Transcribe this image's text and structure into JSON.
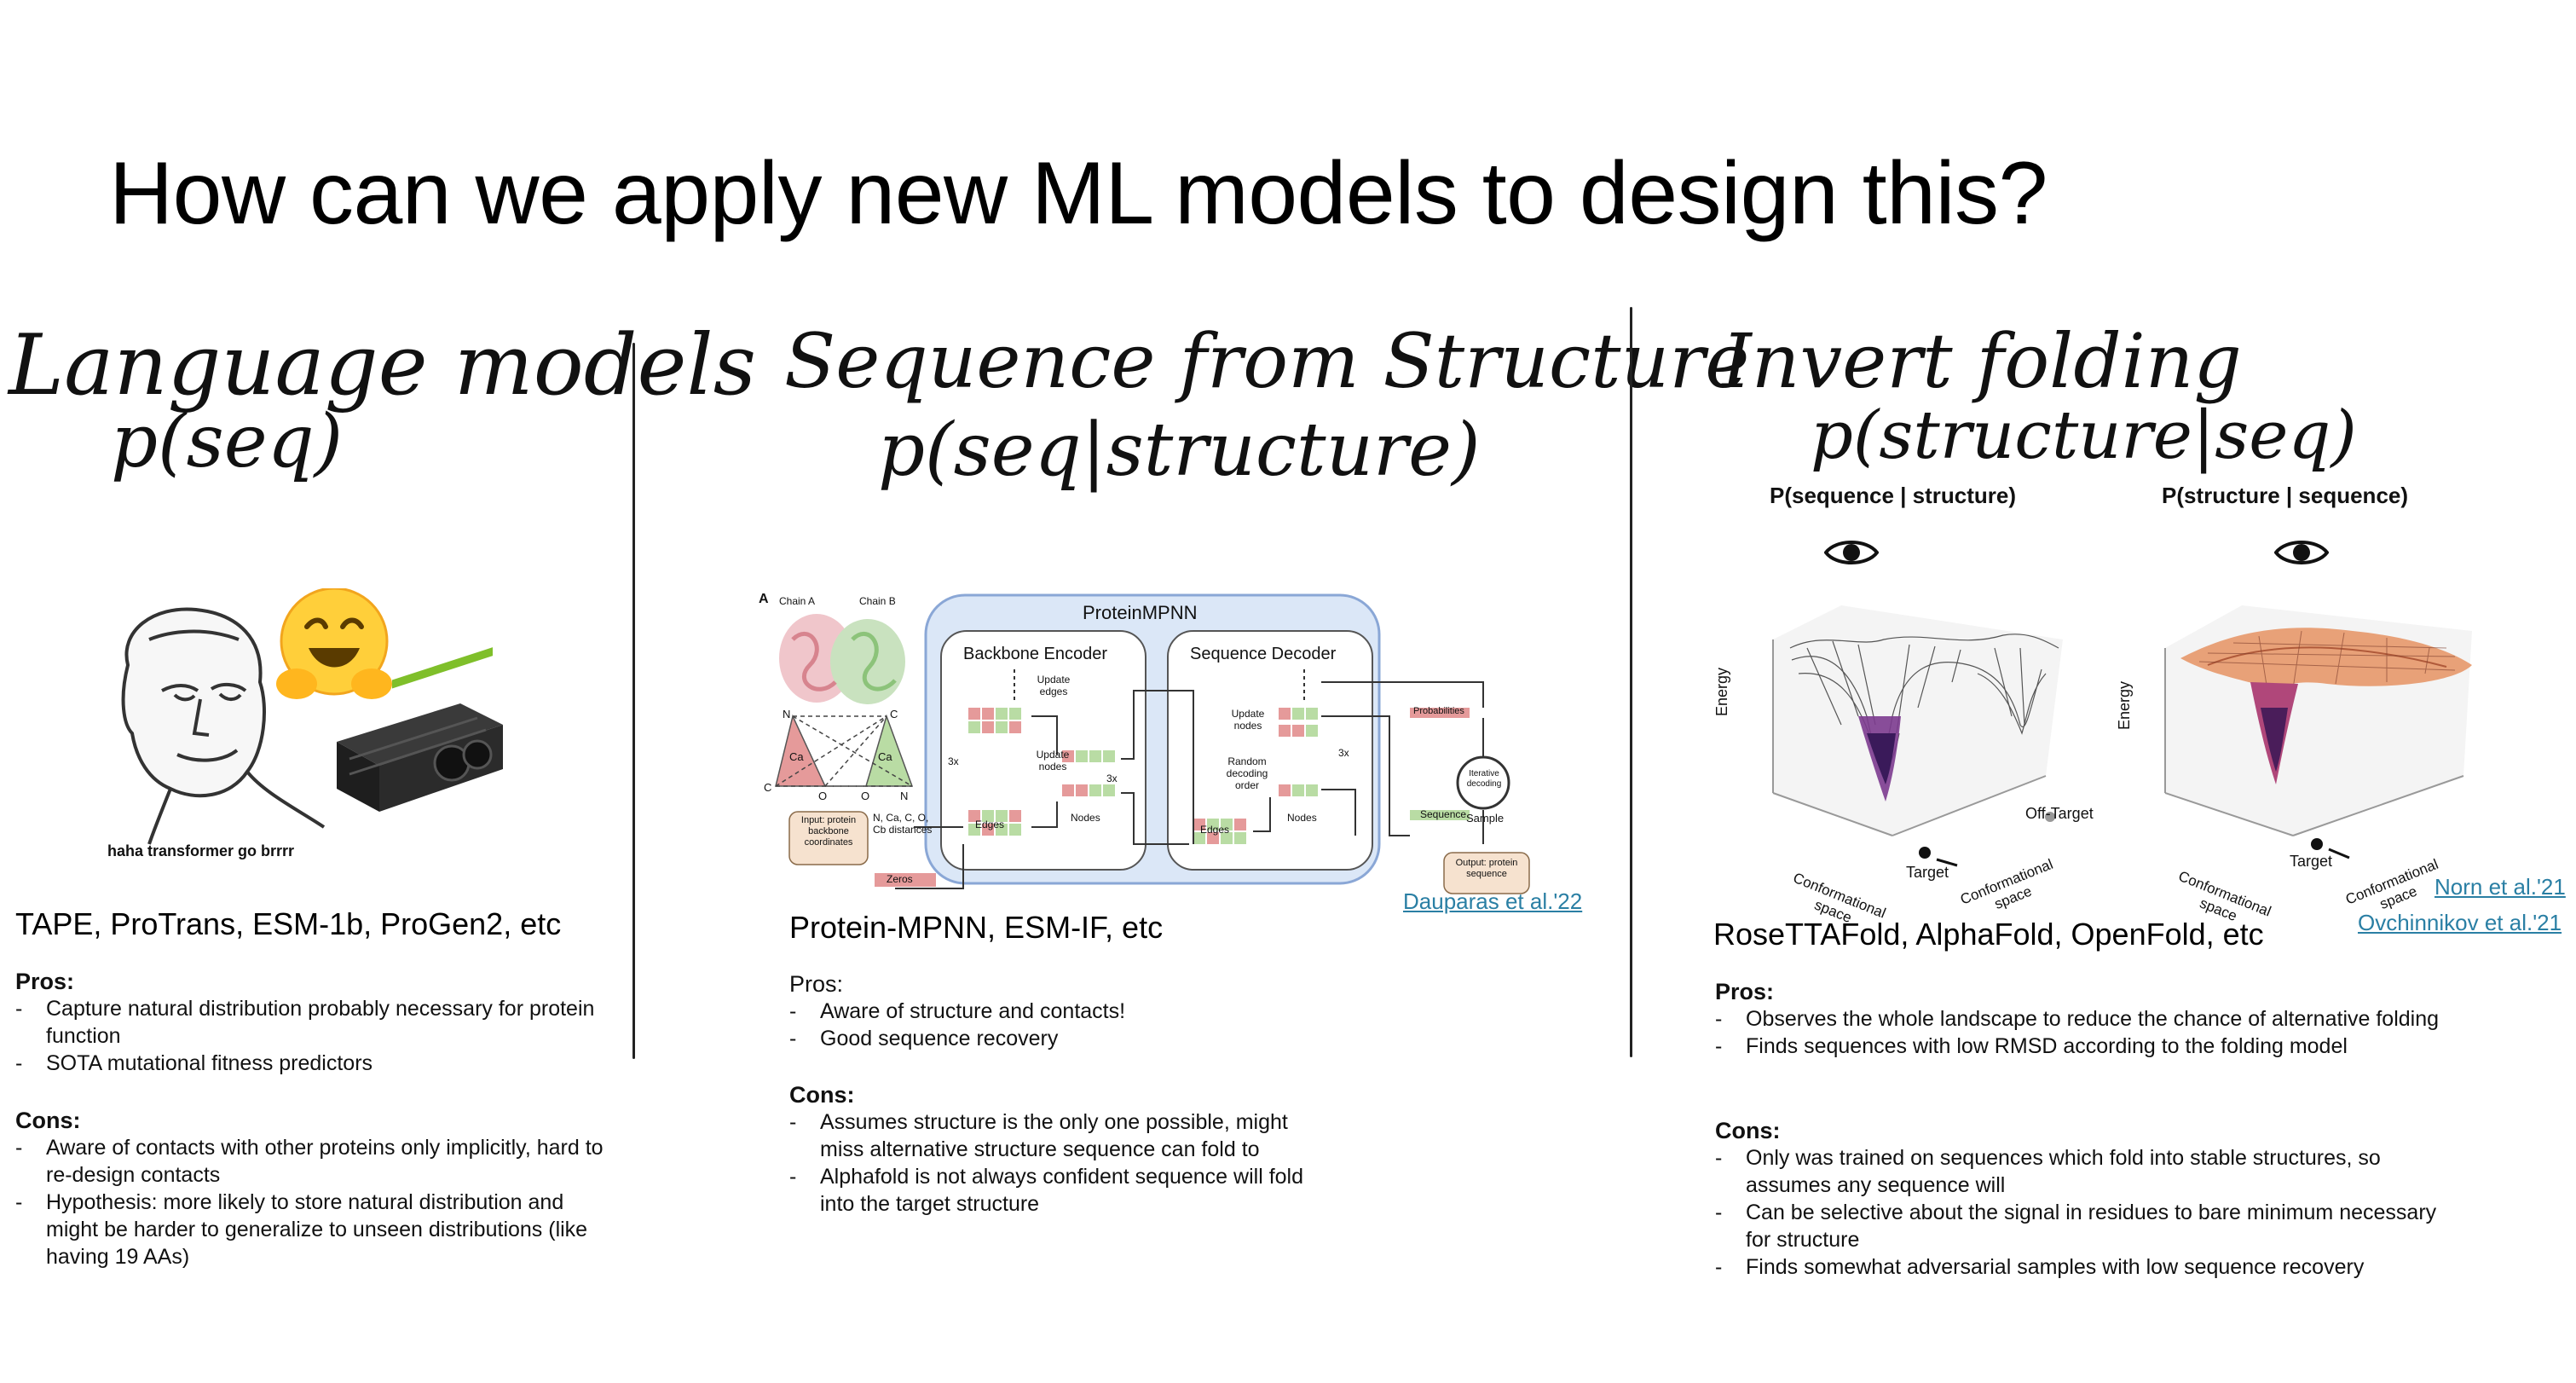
{
  "slide": {
    "title": "How can we apply new ML models to design this?"
  },
  "col1": {
    "handwritten_title": "Language models",
    "handwritten_sub": "p(seq)",
    "meme_caption": "haha transformer go brrrr",
    "models": "TAPE, ProTrans, ESM-1b, ProGen2, etc",
    "pros_label": "Pros:",
    "pros": [
      "Capture natural distribution probably necessary for protein function",
      "SOTA mutational fitness predictors"
    ],
    "cons_label": "Cons:",
    "cons": [
      "Aware of contacts with other proteins only implicitly, hard to re-design contacts",
      "Hypothesis: more likely to store natural distribution and might be harder to generalize to unseen distributions (like having 19 AAs)"
    ]
  },
  "col2": {
    "handwritten_title": "Sequence from Structure",
    "handwritten_sub": "p(seq|structure)",
    "diagram": {
      "panel_letter": "A",
      "chain_a": "Chain A",
      "chain_b": "Chain B",
      "model_title": "ProteinMPNN",
      "encoder": "Backbone Encoder",
      "decoder": "Sequence Decoder",
      "update_edges": "Update edges",
      "update_nodes": "Update nodes",
      "update_nodes_dec": "Update nodes",
      "random_order": "Random decoding order",
      "iterative": "Iterative decoding",
      "sample": "Sample",
      "probabilities": "Probabilities",
      "edges_enc": "Edges",
      "nodes_enc": "Nodes",
      "edges_dec": "Edges",
      "nodes_dec": "Nodes",
      "sequence": "Sequence",
      "zeros": "Zeros",
      "x3_a": "3x",
      "x3_b": "3x",
      "x3_c": "3x",
      "input_label": "Input: protein backbone coordinates",
      "dist_label": "N, Ca, C, O, Cb distances",
      "output_label": "Output: protein sequence",
      "atom_n1": "N",
      "atom_c1": "C",
      "atom_ca1": "Ca",
      "atom_o1": "O",
      "atom_n2": "N",
      "atom_c2": "C",
      "atom_ca2": "Ca",
      "atom_o2": "O"
    },
    "citation": "Dauparas et al.'22",
    "models": "Protein-MPNN, ESM-IF, etc",
    "pros_label": "Pros:",
    "pros": [
      "Aware of structure and contacts!",
      "Good sequence recovery"
    ],
    "cons_label": "Cons:",
    "cons": [
      "Assumes structure is the only one possible, might miss alternative structure sequence can fold to",
      "Alphafold is not always confident sequence will fold into the target structure"
    ]
  },
  "col3": {
    "handwritten_title": "Invert folding",
    "handwritten_sub": "p(structure|seq)",
    "plot1": {
      "title": "P(sequence | structure)",
      "y_label": "Energy",
      "x_label_left": "Conformational space",
      "x_label_right": "Conformational space",
      "off_target": "Off-Target",
      "target": "Target"
    },
    "plot2": {
      "title": "P(structure | sequence)",
      "y_label": "Energy",
      "x_label_left": "Conformational space",
      "x_label_right": "Conformational space",
      "target": "Target"
    },
    "citations": [
      "Norn et al.'21",
      "Ovchinnikov et al.'21"
    ],
    "models": "RoseTTAFold, AlphaFold, OpenFold, etc",
    "pros_label": "Pros:",
    "pros": [
      "Observes the whole landscape to reduce the chance of alternative folding",
      "Finds sequences with low RMSD according to the folding model"
    ],
    "cons_label": "Cons:",
    "cons": [
      "Only was trained on sequences which fold into stable structures, so assumes any sequence will",
      "Can be selective about the signal in residues to bare minimum necessary for structure",
      "Finds somewhat adversarial samples with low sequence recovery"
    ]
  },
  "colors": {
    "link": "#2a7fa4",
    "mpnn_panel": "#dbe7f7",
    "mpnn_border": "#8aa7d6",
    "red_cell": "#e59a9a",
    "green_cell": "#b9dca4",
    "input_box": "#f6e2cf"
  },
  "icons": [
    "hugging-face-emoji-icon",
    "eye-icon",
    "wojak-meme-face",
    "gpu-stack-image"
  ]
}
